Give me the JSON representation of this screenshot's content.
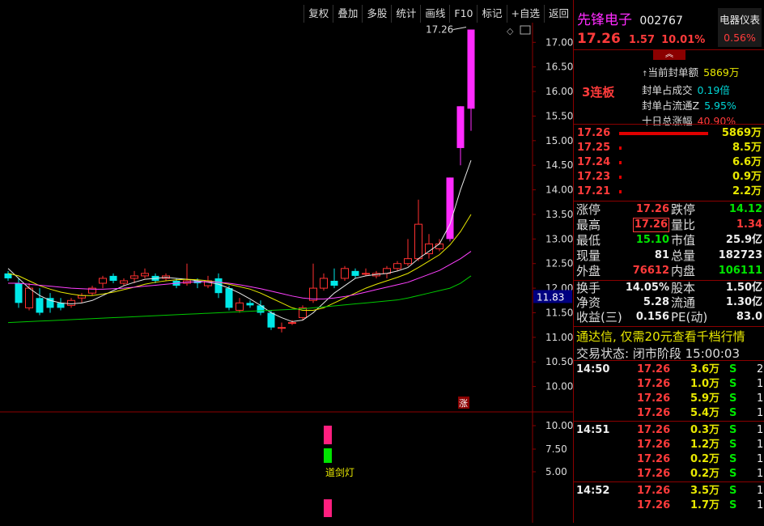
{
  "toolbar": [
    "复权",
    "叠加",
    "多股",
    "统计",
    "画线",
    "F10",
    "标记",
    "+自选",
    "返回"
  ],
  "stock": {
    "name": "先锋电子",
    "code": "002767",
    "price": "17.26",
    "change": "1.57",
    "pct": "10.01%",
    "sector": "电器仪表",
    "sector_pct": "0.56%"
  },
  "seal": {
    "board_label": "3连板",
    "lines": [
      {
        "label": "当前封单额",
        "value": "5869万"
      },
      {
        "label": "封单占成交",
        "value": "0.19倍"
      },
      {
        "label": "封单占流通Z",
        "value": "5.95%"
      },
      {
        "label": "十日总涨幅",
        "value": "40.90%"
      }
    ]
  },
  "orderbook": [
    {
      "price": "17.26",
      "vol": "5869万",
      "bar": 1.0
    },
    {
      "price": "17.25",
      "vol": "8.5万",
      "bar": 0.02
    },
    {
      "price": "17.24",
      "vol": "6.6万",
      "bar": 0.02
    },
    {
      "price": "17.23",
      "vol": "0.9万",
      "bar": 0.02
    },
    {
      "price": "17.21",
      "vol": "2.2万",
      "bar": 0.02
    }
  ],
  "quote": {
    "zt_l": "涨停",
    "zt": "17.26",
    "dt_l": "跌停",
    "dt": "14.12",
    "zg_l": "最高",
    "zg": "17.26",
    "lb_l": "量比",
    "lb": "1.34",
    "zd_l": "最低",
    "zd": "15.10",
    "sz_l": "市值",
    "sz": "25.9亿",
    "xl_l": "现量",
    "xl": "81",
    "zl_l": "总量",
    "zl": "182723",
    "wp_l": "外盘",
    "wp": "76612",
    "np_l": "内盘",
    "np": "106111"
  },
  "fin": {
    "hs_l": "换手",
    "hs": "14.05%",
    "gb_l": "股本",
    "gb": "1.50亿",
    "jz_l": "净资",
    "jz": "5.28",
    "lt_l": "流通",
    "lt": "1.30亿",
    "sy_l": "收益(三)",
    "sy": "0.156",
    "pe_l": "PE(动)",
    "pe": "83.0"
  },
  "promo": "通达信, 仅需20元查看千档行情",
  "status": {
    "label": "交易状态:",
    "value": "闭市阶段",
    "time": "15:00:03"
  },
  "ticks": [
    {
      "time": "14:50",
      "price": "17.26",
      "vol": "3.6万",
      "side": "S",
      "n": "2"
    },
    {
      "time": "",
      "price": "17.26",
      "vol": "1.0万",
      "side": "S",
      "n": "1"
    },
    {
      "time": "",
      "price": "17.26",
      "vol": "5.9万",
      "side": "S",
      "n": "1"
    },
    {
      "time": "",
      "price": "17.26",
      "vol": "5.4万",
      "side": "S",
      "n": "1"
    },
    {
      "time": "14:51",
      "price": "17.26",
      "vol": "0.3万",
      "side": "S",
      "n": "1"
    },
    {
      "time": "",
      "price": "17.26",
      "vol": "1.2万",
      "side": "S",
      "n": "1"
    },
    {
      "time": "",
      "price": "17.26",
      "vol": "0.2万",
      "side": "S",
      "n": "1"
    },
    {
      "time": "",
      "price": "17.26",
      "vol": "0.2万",
      "side": "S",
      "n": "1"
    },
    {
      "time": "14:52",
      "price": "17.26",
      "vol": "3.5万",
      "side": "S",
      "n": "1"
    },
    {
      "time": "",
      "price": "17.26",
      "vol": "1.7万",
      "side": "S",
      "n": "1"
    }
  ],
  "chart_data": {
    "type": "candlestick",
    "y_axis": {
      "min": 9.5,
      "max": 17.4,
      "ticks": [
        "17.00",
        "16.50",
        "16.00",
        "15.50",
        "15.00",
        "14.50",
        "14.00",
        "13.50",
        "13.00",
        "12.50",
        "12.00",
        "11.50",
        "11.00",
        "10.50",
        "10.00"
      ]
    },
    "current_price_label": "11.83",
    "high_annotation": "17.26",
    "limit_marker": "涨",
    "candles": [
      {
        "o": 12.3,
        "c": 12.2,
        "h": 12.35,
        "l": 12.15
      },
      {
        "o": 12.1,
        "c": 11.7,
        "h": 12.2,
        "l": 11.6
      },
      {
        "o": 11.6,
        "c": 12.0,
        "h": 12.1,
        "l": 11.55
      },
      {
        "o": 11.8,
        "c": 11.5,
        "h": 12.0,
        "l": 11.45
      },
      {
        "o": 11.8,
        "c": 11.6,
        "h": 11.9,
        "l": 11.5
      },
      {
        "o": 11.7,
        "c": 11.6,
        "h": 11.8,
        "l": 11.55
      },
      {
        "o": 11.65,
        "c": 11.75,
        "h": 11.8,
        "l": 11.6
      },
      {
        "o": 11.8,
        "c": 11.85,
        "h": 11.9,
        "l": 11.7
      },
      {
        "o": 11.9,
        "c": 12.0,
        "h": 12.05,
        "l": 11.85
      },
      {
        "o": 12.1,
        "c": 12.2,
        "h": 12.25,
        "l": 12.0
      },
      {
        "o": 12.25,
        "c": 12.15,
        "h": 12.3,
        "l": 12.1
      },
      {
        "o": 12.1,
        "c": 12.15,
        "h": 12.2,
        "l": 12.05
      },
      {
        "o": 12.2,
        "c": 12.25,
        "h": 12.35,
        "l": 12.1
      },
      {
        "o": 12.25,
        "c": 12.3,
        "h": 12.4,
        "l": 12.2
      },
      {
        "o": 12.25,
        "c": 12.15,
        "h": 12.3,
        "l": 12.1
      },
      {
        "o": 12.2,
        "c": 12.25,
        "h": 12.3,
        "l": 12.15
      },
      {
        "o": 12.15,
        "c": 12.05,
        "h": 12.2,
        "l": 12.0
      },
      {
        "o": 12.1,
        "c": 12.15,
        "h": 12.5,
        "l": 12.05
      },
      {
        "o": 12.15,
        "c": 12.1,
        "h": 12.2,
        "l": 12.0
      },
      {
        "o": 12.05,
        "c": 12.15,
        "h": 12.25,
        "l": 12.0
      },
      {
        "o": 12.2,
        "c": 11.9,
        "h": 12.3,
        "l": 11.8
      },
      {
        "o": 12.0,
        "c": 11.6,
        "h": 12.05,
        "l": 11.55
      },
      {
        "o": 11.55,
        "c": 11.7,
        "h": 11.8,
        "l": 11.5
      },
      {
        "o": 11.7,
        "c": 11.65,
        "h": 11.75,
        "l": 11.6
      },
      {
        "o": 11.65,
        "c": 11.5,
        "h": 11.75,
        "l": 11.45
      },
      {
        "o": 11.5,
        "c": 11.2,
        "h": 11.55,
        "l": 11.15
      },
      {
        "o": 11.2,
        "c": 11.2,
        "h": 11.3,
        "l": 11.1
      },
      {
        "o": 11.3,
        "c": 11.3,
        "h": 11.35,
        "l": 11.25
      },
      {
        "o": 11.4,
        "c": 11.6,
        "h": 11.65,
        "l": 11.35
      },
      {
        "o": 11.75,
        "c": 12.0,
        "h": 12.5,
        "l": 11.7
      },
      {
        "o": 12.0,
        "c": 12.2,
        "h": 12.3,
        "l": 11.95
      },
      {
        "o": 12.15,
        "c": 12.05,
        "h": 12.4,
        "l": 12.0
      },
      {
        "o": 12.2,
        "c": 12.4,
        "h": 12.45,
        "l": 12.15
      },
      {
        "o": 12.35,
        "c": 12.25,
        "h": 12.4,
        "l": 12.2
      },
      {
        "o": 12.3,
        "c": 12.3,
        "h": 12.4,
        "l": 12.25
      },
      {
        "o": 12.25,
        "c": 12.3,
        "h": 12.35,
        "l": 12.2
      },
      {
        "o": 12.3,
        "c": 12.4,
        "h": 12.45,
        "l": 12.2
      },
      {
        "o": 12.4,
        "c": 12.5,
        "h": 12.55,
        "l": 12.35
      },
      {
        "o": 12.5,
        "c": 12.6,
        "h": 13.0,
        "l": 12.45
      },
      {
        "o": 12.6,
        "c": 13.3,
        "h": 13.8,
        "l": 12.55
      },
      {
        "o": 12.7,
        "c": 12.9,
        "h": 13.1,
        "l": 12.6
      },
      {
        "o": 12.8,
        "c": 12.9,
        "h": 13.0,
        "l": 12.75
      },
      {
        "o": 13.0,
        "c": 14.25,
        "h": 14.25,
        "l": 12.95
      },
      {
        "o": 14.85,
        "c": 15.7,
        "h": 15.7,
        "l": 14.5
      },
      {
        "o": 15.65,
        "c": 17.26,
        "h": 17.26,
        "l": 15.2
      }
    ],
    "ma": [
      {
        "name": "MA5",
        "color": "#e8e8e8",
        "values": [
          12.4,
          12.2,
          12.0,
          11.85,
          11.75,
          11.7,
          11.68,
          11.7,
          11.75,
          11.85,
          11.95,
          12.05,
          12.12,
          12.18,
          12.2,
          12.22,
          12.2,
          12.18,
          12.15,
          12.12,
          12.08,
          12.0,
          11.9,
          11.78,
          11.65,
          11.5,
          11.4,
          11.32,
          11.35,
          11.5,
          11.7,
          11.9,
          12.05,
          12.2,
          12.25,
          12.28,
          12.3,
          12.35,
          12.42,
          12.6,
          12.75,
          12.9,
          13.3,
          14.0,
          14.6
        ]
      },
      {
        "name": "MA10",
        "color": "#e8e800",
        "values": [
          12.3,
          12.25,
          12.15,
          12.05,
          11.98,
          11.92,
          11.88,
          11.85,
          11.85,
          11.88,
          11.92,
          11.97,
          12.02,
          12.08,
          12.12,
          12.15,
          12.17,
          12.18,
          12.17,
          12.15,
          12.12,
          12.08,
          12.03,
          11.98,
          11.9,
          11.8,
          11.7,
          11.6,
          11.55,
          11.55,
          11.6,
          11.7,
          11.8,
          11.9,
          12.0,
          12.08,
          12.15,
          12.22,
          12.3,
          12.42,
          12.55,
          12.68,
          12.88,
          13.15,
          13.5
        ]
      },
      {
        "name": "MA20",
        "color": "#ff40ff",
        "values": [
          12.1,
          12.1,
          12.08,
          12.06,
          12.04,
          12.02,
          12.0,
          11.99,
          11.98,
          11.98,
          11.99,
          12.0,
          12.02,
          12.04,
          12.06,
          12.08,
          12.1,
          12.12,
          12.13,
          12.13,
          12.12,
          12.1,
          12.07,
          12.03,
          11.99,
          11.94,
          11.89,
          11.84,
          11.8,
          11.78,
          11.78,
          11.8,
          11.83,
          11.87,
          11.92,
          11.97,
          12.02,
          12.07,
          12.12,
          12.2,
          12.28,
          12.36,
          12.48,
          12.6,
          12.75
        ]
      },
      {
        "name": "MA60",
        "color": "#00c800",
        "values": [
          11.3,
          11.31,
          11.32,
          11.33,
          11.34,
          11.35,
          11.36,
          11.37,
          11.38,
          11.39,
          11.4,
          11.41,
          11.42,
          11.43,
          11.44,
          11.45,
          11.46,
          11.47,
          11.48,
          11.49,
          11.5,
          11.51,
          11.52,
          11.53,
          11.54,
          11.55,
          11.56,
          11.57,
          11.58,
          11.6,
          11.62,
          11.64,
          11.66,
          11.68,
          11.7,
          11.72,
          11.74,
          11.76,
          11.8,
          11.85,
          11.9,
          11.95,
          12.0,
          12.1,
          12.25
        ]
      }
    ],
    "indicator": {
      "y_ticks": [
        "10.00",
        "7.50",
        "5.00"
      ],
      "label": "道剑灯",
      "bars": [
        {
          "color": "#ff1f7f",
          "level": "top"
        },
        {
          "color": "#00e400",
          "level": "mid"
        },
        {
          "color": "#ff1f7f",
          "level": "bottom"
        }
      ]
    }
  }
}
